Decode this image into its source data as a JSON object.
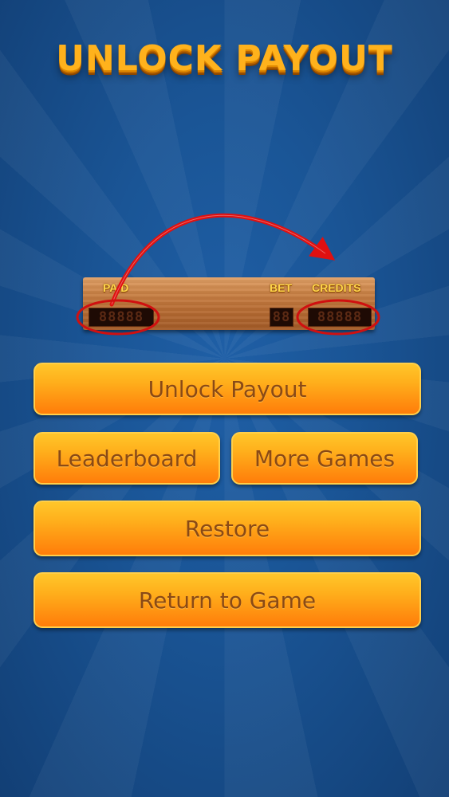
{
  "title": "UNLOCK PAYOUT",
  "board": {
    "paid_label": "PAID",
    "bet_label": "BET",
    "credits_label": "CREDITS",
    "paid_display": "88888",
    "bet_display": "88",
    "credits_display": "88888"
  },
  "buttons": {
    "unlock": "Unlock Payout",
    "leaderboard": "Leaderboard",
    "more_games": "More Games",
    "restore": "Restore",
    "return": "Return to Game"
  },
  "colors": {
    "background": "#1a5596",
    "title": "#ffb21c",
    "button": "#ffa018",
    "button_text": "#8a4a16",
    "annotation": "#e01010"
  },
  "icons": [
    "curved-arrow-icon",
    "highlight-ellipse-icon"
  ]
}
